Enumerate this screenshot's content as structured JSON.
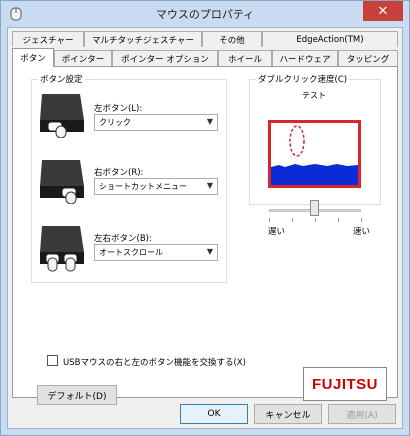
{
  "window": {
    "title": "マウスのプロパティ",
    "close_label": "✕"
  },
  "tabs_row1": [
    "ジェスチャー",
    "マルチタッチジェスチャー",
    "その他",
    "EdgeAction(TM)"
  ],
  "tabs_row2": [
    "ボタン",
    "ポインター",
    "ポインター オプション",
    "ホイール",
    "ハードウェア",
    "タッピング"
  ],
  "active_tab": "ボタン",
  "buttons_group": {
    "label": "ボタン設定",
    "left": {
      "label": "左ボタン(L):",
      "value": "クリック"
    },
    "right": {
      "label": "右ボタン(R):",
      "value": "ショートカットメニュー"
    },
    "both": {
      "label": "左右ボタン(B):",
      "value": "オートスクロール"
    }
  },
  "double_click": {
    "label": "ダブルクリック速度(C)",
    "test_label": "テスト",
    "slow_label": "遅い",
    "fast_label": "速い",
    "speed_fraction": 0.5
  },
  "swap_checkbox": {
    "label": "USBマウスの右と左のボタン機能を交換する(X)",
    "checked": false
  },
  "default_button": "デフォルト(D)",
  "logo": "FUJITSU",
  "footer": {
    "ok": "OK",
    "cancel": "キャンセル",
    "apply": "適用(A)"
  }
}
